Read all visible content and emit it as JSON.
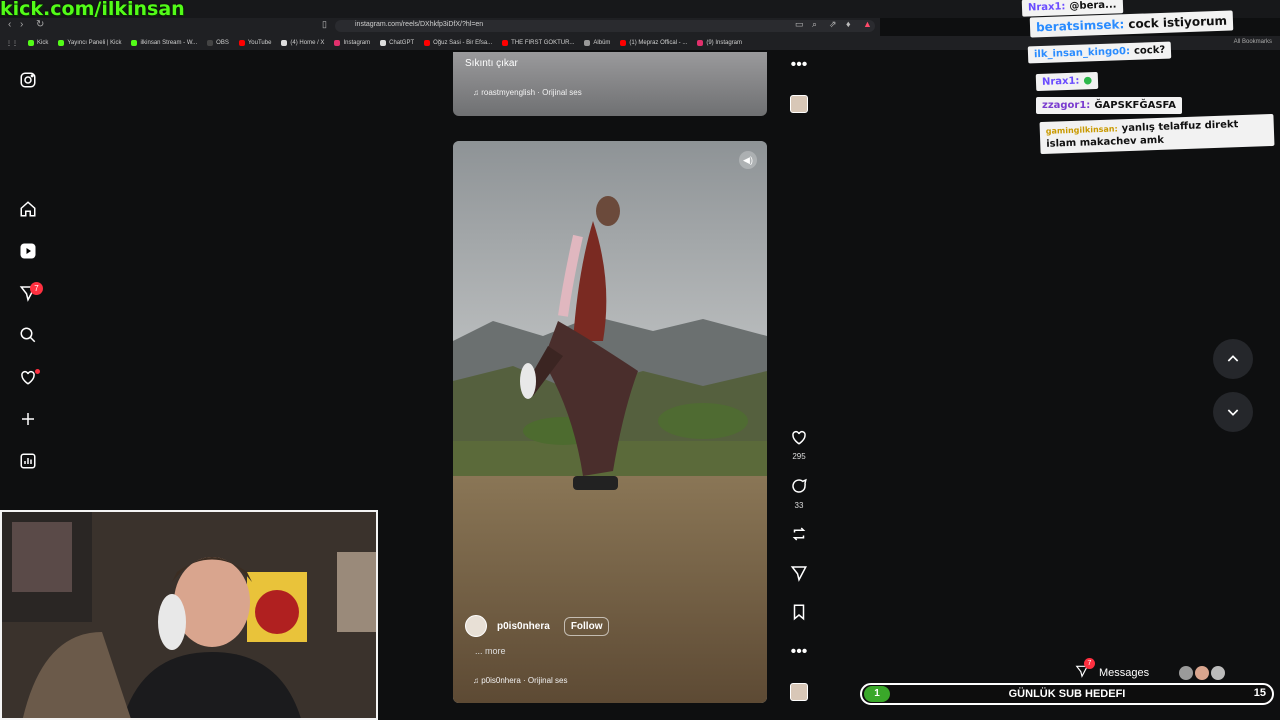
{
  "stream": {
    "watermark": "kick.com/ilkinsan"
  },
  "browser": {
    "url": "instagram.com/reels/DXhkfp3iDfX/?hl=en",
    "bookmarks": [
      {
        "label": "Kick",
        "color": "#53fc18"
      },
      {
        "label": "Yayıncı Paneli | Kick",
        "color": "#53fc18"
      },
      {
        "label": "ilkinsan Stream - W...",
        "color": "#53fc18"
      },
      {
        "label": "OBS",
        "color": "#444"
      },
      {
        "label": "YouTube",
        "color": "#ff0000"
      },
      {
        "label": "(4) Home / X",
        "color": "#ddd"
      },
      {
        "label": "Instagram",
        "color": "#e1306c"
      },
      {
        "label": "ChatGPT",
        "color": "#ddd"
      },
      {
        "label": "Oğuz Sasi - Bir Efsa...",
        "color": "#ff0000"
      },
      {
        "label": "THE FIRST GOKTUR...",
        "color": "#ff0000"
      },
      {
        "label": "Albüm",
        "color": "#999"
      },
      {
        "label": "(1) Mepraz Offical - ...",
        "color": "#ff0000"
      },
      {
        "label": "(9) Instagram",
        "color": "#e1306c"
      }
    ],
    "all_bookmarks": "All Bookmarks"
  },
  "instagram": {
    "nav_badge": "7",
    "reel_top": {
      "caption": "Sıkıntı çıkar",
      "audio": "roastmyenglish · Orijinal ses"
    },
    "reel_main": {
      "username": "p0is0nhera",
      "follow_label": "Follow",
      "more_label": "... more",
      "audio": "p0is0nhera · Orijinal ses",
      "likes": "295",
      "comments": "33"
    },
    "messages_label": "Messages",
    "messages_badge": "7"
  },
  "chat": [
    {
      "user": "Nrax1:",
      "text": "@bera...",
      "ucolor": "#6a4cff"
    },
    {
      "user": "beratsimsek:",
      "text": "cock istiyorum",
      "ucolor": "#2a8cff"
    },
    {
      "user": "ilk_insan_kingo0:",
      "text": "cock?",
      "ucolor": "#2a8cff"
    },
    {
      "user": "Nrax1:",
      "text": "",
      "ucolor": "#6a4cff"
    },
    {
      "user": "zzagor1:",
      "text": "ĞAPSKFĞASFA",
      "ucolor": "#7a3ccf"
    },
    {
      "user": "gamingilkinsan:",
      "text": "yanlış telaffuz direkt islam makachev amk",
      "ucolor": "#c99a00"
    }
  ],
  "sub_goal": {
    "current": "1",
    "label": "GÜNLÜK SUB HEDEFI",
    "target": "15"
  },
  "colors": {
    "accent_green": "#53fc18",
    "badge_red": "#ff3040"
  }
}
